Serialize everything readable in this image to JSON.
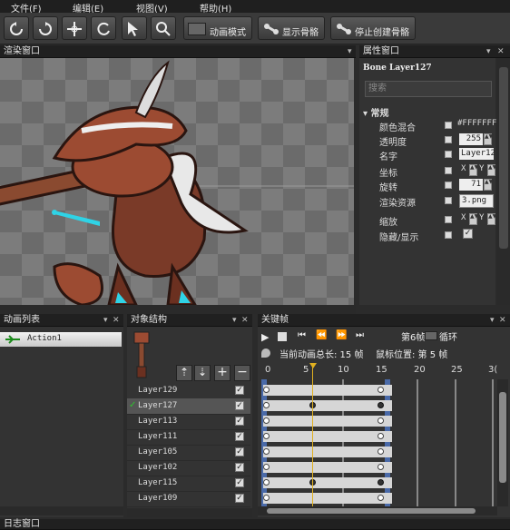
{
  "menu": [
    "文件(F)",
    "编辑(E)",
    "视图(V)",
    "帮助(H)"
  ],
  "toolbar": {
    "anim_mode": "动画模式",
    "show_bones": "显示骨骼",
    "stop_create_bones": "停止创建骨骼"
  },
  "render_window": {
    "title": "渲染窗口"
  },
  "property_window": {
    "title": "属性窗口",
    "header": "Bone Layer127",
    "search_placeholder": "搜索",
    "section": "常规",
    "rows": [
      {
        "label": "颜色混合",
        "value": "#FFFFFFFF"
      },
      {
        "label": "透明度",
        "value": "255"
      },
      {
        "label": "名字",
        "value": "Layer12"
      },
      {
        "label": "坐标",
        "x": "X",
        "y": "Y"
      },
      {
        "label": "旋转",
        "value": "71"
      },
      {
        "label": "渲染资源",
        "value": "3.png"
      },
      {
        "label": "缩放",
        "x": "X",
        "y": "Y"
      },
      {
        "label": "隐藏/显示"
      }
    ]
  },
  "anim_list": {
    "title": "动画列表",
    "items": [
      "Action1"
    ]
  },
  "object_structure": {
    "title": "对象结构",
    "layers": [
      {
        "name": "Layer129",
        "checked": true,
        "selected": false
      },
      {
        "name": "Layer127",
        "checked": true,
        "selected": true
      },
      {
        "name": "Layer113",
        "checked": true,
        "selected": false
      },
      {
        "name": "Layer111",
        "checked": true,
        "selected": false
      },
      {
        "name": "Layer105",
        "checked": true,
        "selected": false
      },
      {
        "name": "Layer102",
        "checked": true,
        "selected": false
      },
      {
        "name": "Layer115",
        "checked": true,
        "selected": false
      },
      {
        "name": "Layer109",
        "checked": true,
        "selected": false
      }
    ]
  },
  "keyframes": {
    "title": "关键帧",
    "frame_label": "第6帧",
    "loop_label": "循环",
    "total_frames_label": "当前动画总长: 15 帧",
    "mouse_pos_label": "鼠标位置: 第 5 帧",
    "ticks": [
      "0",
      "5",
      "10",
      "15",
      "20",
      "25",
      "3("
    ],
    "track_count": 8
  },
  "log_window": {
    "title": "日志窗口"
  },
  "colors": {
    "accent_cyan": "#2fd3e6",
    "track_blue": "#4a6aa8",
    "playhead": "#e0b020"
  }
}
